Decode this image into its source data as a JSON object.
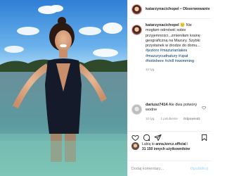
{
  "post_header": {
    "username": "katarzynacichopel",
    "separator": "•",
    "follow_label": "Obserwowanie"
  },
  "caption": {
    "username": "katarzynacichopel",
    "text": "🙂 Nie mogłam odmówić sobie przyjemności...zmieniłam krainę geograficzną na Mazury. Szybki przystanek w drodze do domu...",
    "hashtags": "#jezioro #mazurianlakes #mazurycudnatury #upał #hotinhere #chill #swimming",
    "time": "12 tyg."
  },
  "comment": {
    "username": "dariusz7414",
    "text": "Ale dwa potwory wodne",
    "time": "10 tyg.",
    "likes": "1 polubienie",
    "reply_label": "Odpowiedz"
  },
  "likes": {
    "prefix": "Lubią to",
    "user": "anna.korcz.official",
    "connector": "i",
    "count": "31 150 innych użytkowników"
  },
  "add_comment": {
    "placeholder": "Dodaj komentarz...",
    "publish_label": "Opublikuj"
  },
  "icons": {
    "like": "heart-icon",
    "comment": "comment-icon",
    "share": "share-icon",
    "save": "bookmark-icon"
  }
}
